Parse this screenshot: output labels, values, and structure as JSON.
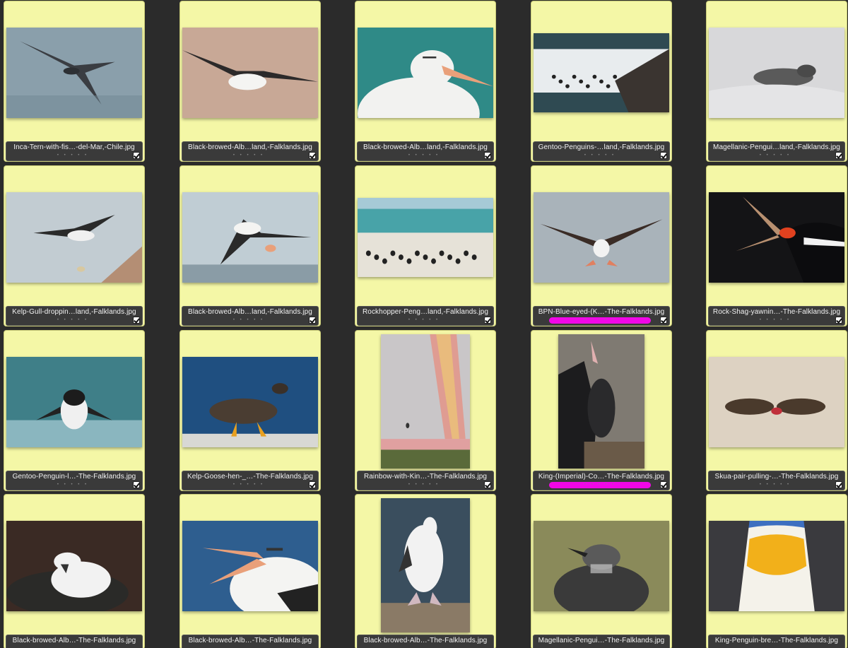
{
  "thumbnails": [
    {
      "filename": "Inca-Tern-with-fis…-del-Mar,-Chile.jpg",
      "rating_dots": "• • • • •",
      "checked": true,
      "label_color": "",
      "subject": "tern-in-flight",
      "palette": [
        "#8a9fab",
        "#3a3d42"
      ]
    },
    {
      "filename": "Black-browed-Alb…land,-Falklands.jpg",
      "rating_dots": "• • • • •",
      "checked": true,
      "label_color": "",
      "subject": "albatross-in-flight",
      "palette": [
        "#c8a896",
        "#2c2a2a"
      ]
    },
    {
      "filename": "Black-browed-Alb…land,-Falklands.jpg",
      "rating_dots": "• • • • •",
      "checked": true,
      "label_color": "",
      "subject": "albatross-portrait",
      "palette": [
        "#2f8a87",
        "#f2f2f0"
      ]
    },
    {
      "filename": "Gentoo-Penguins-…land,-Falklands.jpg",
      "rating_dots": "• • • • •",
      "checked": true,
      "label_color": "",
      "subject": "penguins-in-surf",
      "palette": [
        "#2f4a52",
        "#e8ecee"
      ]
    },
    {
      "filename": "Magellanic-Pengui…land,-Falklands.jpg",
      "rating_dots": "• • • • •",
      "checked": true,
      "label_color": "",
      "subject": "penguin-on-sand",
      "palette": [
        "#d8d8da",
        "#5a5a5a"
      ]
    },
    {
      "filename": "Kelp-Gull-droppin…land,-Falklands.jpg",
      "rating_dots": "• • • • •",
      "checked": true,
      "label_color": "",
      "subject": "gull-dropping-shell",
      "palette": [
        "#c2ccd2",
        "#2a2a2a"
      ]
    },
    {
      "filename": "Black-browed-Alb…land,-Falklands.jpg",
      "rating_dots": "• • • • •",
      "checked": true,
      "label_color": "",
      "subject": "albatross-landing",
      "palette": [
        "#c0cdd4",
        "#2a2a2a"
      ]
    },
    {
      "filename": "Rockhopper-Peng…land,-Falklands.jpg",
      "rating_dots": "• • • • •",
      "checked": true,
      "label_color": "",
      "subject": "penguins-on-beach",
      "palette": [
        "#48a3a8",
        "#e6e2d8"
      ]
    },
    {
      "filename": "BPN-Blue-eyed-(K…-The-Falklands.jpg",
      "rating_dots": "• • • • •",
      "checked": true,
      "label_color": "#f107e7",
      "subject": "shag-wings-spread",
      "palette": [
        "#a9b3ba",
        "#3a2c26"
      ]
    },
    {
      "filename": "Rock-Shag-yawnin…-The-Falklands.jpg",
      "rating_dots": "• • • • •",
      "checked": true,
      "label_color": "",
      "subject": "shag-yawning",
      "palette": [
        "#141416",
        "#e0411f"
      ]
    },
    {
      "filename": "Gentoo-Penguin-l…-The-Falklands.jpg",
      "rating_dots": "• • • • •",
      "checked": true,
      "label_color": "",
      "subject": "penguin-landing",
      "palette": [
        "#3f7f88",
        "#f0f0f0"
      ]
    },
    {
      "filename": "Kelp-Goose-hen-_…-The-Falklands.jpg",
      "rating_dots": "• • • • •",
      "checked": true,
      "label_color": "",
      "subject": "goose-on-beach",
      "palette": [
        "#1f4f80",
        "#4a3d32"
      ]
    },
    {
      "filename": "Rainbow-with-Kin…-The-Falklands.jpg",
      "rating_dots": "• • • • •",
      "checked": true,
      "label_color": "",
      "subject": "rainbow",
      "palette": [
        "#c9c6c8",
        "#e05a5a"
      ]
    },
    {
      "filename": "King-(Imperial)-Co…-The-Falklands.jpg",
      "rating_dots": "• • • • •",
      "checked": true,
      "label_color": "#f107e7",
      "subject": "cormorant-chicks",
      "palette": [
        "#7f7a72",
        "#1c1c1e"
      ]
    },
    {
      "filename": "Skua-pair-pulling-…-The-Falklands.jpg",
      "rating_dots": "• • • • •",
      "checked": true,
      "label_color": "",
      "subject": "skua-pair",
      "palette": [
        "#ddd2c2",
        "#4a3a2c"
      ]
    },
    {
      "filename": "Black-browed-Alb…-The-Falklands.jpg",
      "rating_dots": "",
      "checked": false,
      "label_color": "",
      "subject": "albatross-chick",
      "palette": [
        "#3a2a24",
        "#f2f2f2"
      ]
    },
    {
      "filename": "Black-browed-Alb…-The-Falklands.jpg",
      "rating_dots": "",
      "checked": false,
      "label_color": "",
      "subject": "albatross-calling",
      "palette": [
        "#2e5e8f",
        "#f4f4f2"
      ]
    },
    {
      "filename": "Black-browed-Alb…-The-Falklands.jpg",
      "rating_dots": "",
      "checked": false,
      "label_color": "",
      "subject": "albatross-on-rock",
      "palette": [
        "#3a4e5e",
        "#f2f2f2"
      ]
    },
    {
      "filename": "Magellanic-Pengui…-The-Falklands.jpg",
      "rating_dots": "",
      "checked": false,
      "label_color": "",
      "subject": "penguin-chick",
      "palette": [
        "#8a8a5a",
        "#3a3a3a"
      ]
    },
    {
      "filename": "King-Penguin-bre…-The-Falklands.jpg",
      "rating_dots": "",
      "checked": false,
      "label_color": "",
      "subject": "king-penguin-breast",
      "palette": [
        "#3d6fc0",
        "#f2b01a"
      ]
    }
  ]
}
